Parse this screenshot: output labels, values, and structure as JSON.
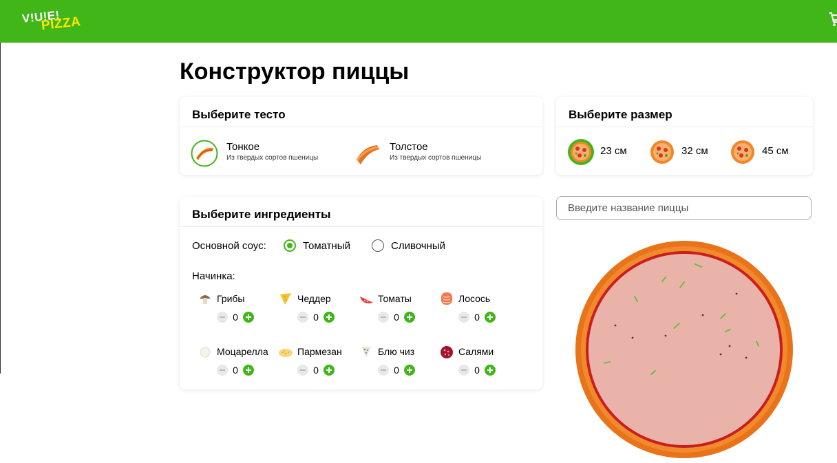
{
  "header": {
    "logo_line1": "V!U!E!",
    "logo_line2": "PIZZA",
    "cart_icon": "cart-icon",
    "color": "#41b619"
  },
  "page": {
    "title": "Конструктор пиццы"
  },
  "dough": {
    "title": "Выберите тесто",
    "options": [
      {
        "name": "Тонкое",
        "desc": "Из твердых сортов пшеницы",
        "selected": true,
        "icon": "thin-dough-icon"
      },
      {
        "name": "Толстое",
        "desc": "Из твердых сортов пшеницы",
        "selected": false,
        "icon": "thick-dough-icon"
      }
    ]
  },
  "size": {
    "title": "Выберите размер",
    "options": [
      {
        "label": "23 см",
        "selected": true
      },
      {
        "label": "32 см",
        "selected": false
      },
      {
        "label": "45 см",
        "selected": false
      }
    ]
  },
  "ingredients": {
    "title": "Выберите ингредиенты",
    "sauce_label": "Основной соус:",
    "sauces": [
      {
        "label": "Томатный",
        "selected": true
      },
      {
        "label": "Сливочный",
        "selected": false
      }
    ],
    "filling_label": "Начинка:",
    "items": [
      {
        "name": "Грибы",
        "qty": "0",
        "icon": "mushroom-icon"
      },
      {
        "name": "Чеддер",
        "qty": "0",
        "icon": "cheddar-icon"
      },
      {
        "name": "Томаты",
        "qty": "0",
        "icon": "tomato-icon"
      },
      {
        "name": "Лосось",
        "qty": "0",
        "icon": "salmon-icon"
      },
      {
        "name": "Моцарелла",
        "qty": "0",
        "icon": "mozzarella-icon"
      },
      {
        "name": "Пармезан",
        "qty": "0",
        "icon": "parmesan-icon"
      },
      {
        "name": "Блю чиз",
        "qty": "0",
        "icon": "blue-cheese-icon"
      },
      {
        "name": "Салями",
        "qty": "0",
        "icon": "salami-icon"
      }
    ]
  },
  "pizza_name": {
    "placeholder": "Введите название пиццы"
  }
}
